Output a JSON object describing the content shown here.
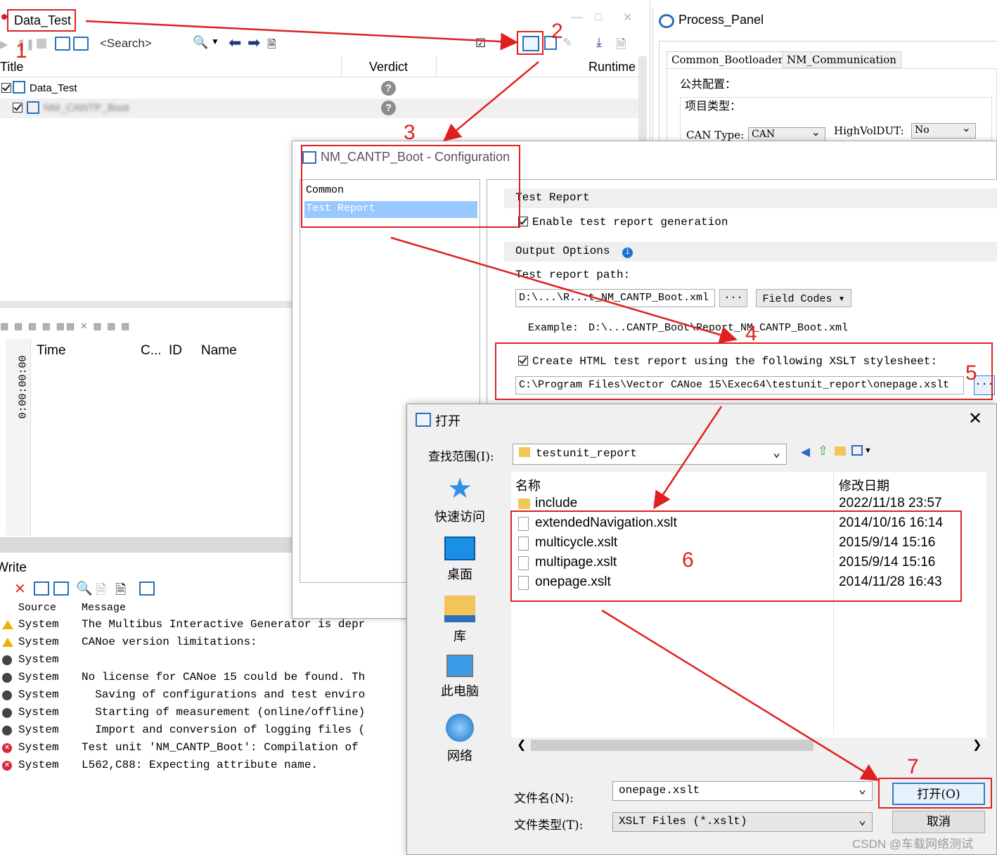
{
  "test_window": {
    "title": "Data_Test",
    "search_placeholder": "<Search>",
    "columns": [
      "Title",
      "Verdict",
      "Runtime"
    ],
    "rows": [
      {
        "label": "Data_Test",
        "verdict": "?"
      },
      {
        "label": "NM_CANTP_Boot",
        "verdict": "?"
      }
    ]
  },
  "process_panel": {
    "title": "Process_Panel",
    "tabs": [
      "Common_Bootloader",
      "NM_Communication"
    ],
    "group_common": "公共配置：",
    "group_project": "项目类型：",
    "can_type_label": "CAN Type:",
    "can_type_value": "CAN",
    "highvol_label": "HighVolDUT:",
    "highvol_value": "No"
  },
  "trace": {
    "time_col": "Time",
    "c_col": "C...",
    "id_col": "ID",
    "name_col": "Name",
    "time_value": "0:00:00:00"
  },
  "write": {
    "title": "Write",
    "columns": [
      "Source",
      "Message"
    ],
    "rows": [
      {
        "type": "warn",
        "source": "System",
        "message": "The Multibus Interactive Generator is depr"
      },
      {
        "type": "warn",
        "source": "System",
        "message": "CANoe version limitations:"
      },
      {
        "type": "info",
        "source": "System",
        "message": ""
      },
      {
        "type": "info",
        "source": "System",
        "message": "No license for CANoe 15 could be found. Th"
      },
      {
        "type": "info",
        "source": "System",
        "message": "  Saving of configurations and test enviro"
      },
      {
        "type": "info",
        "source": "System",
        "message": "  Starting of measurement (online/offline)"
      },
      {
        "type": "info",
        "source": "System",
        "message": "  Import and conversion of logging files ("
      },
      {
        "type": "error",
        "source": "System",
        "message": "Test unit 'NM_CANTP_Boot': Compilation of"
      },
      {
        "type": "error",
        "source": "System",
        "message": "L562,C88: Expecting attribute name."
      }
    ]
  },
  "config_dialog": {
    "title": "NM_CANTP_Boot - Configuration",
    "nav_items": [
      "Common",
      "Test Report"
    ],
    "selected_nav": "Test Report",
    "section_test_report": "Test Report",
    "enable_label": "Enable test report generation",
    "section_output": "Output Options",
    "path_label": "Test report path:",
    "path_value": "D:\\...\\R...t_NM_CANTP_Boot.xml",
    "browse_label": "...",
    "field_codes_label": "Field Codes",
    "example_label": "Example:",
    "example_value": "D:\\...CANTP_Boot\\Report_NM_CANTP_Boot.xml",
    "html_label": "Create HTML test report using the following XSLT stylesheet:",
    "xslt_path": "C:\\Program Files\\Vector CANoe 15\\Exec64\\testunit_report\\onepage.xslt",
    "xslt_browse": "..."
  },
  "open_dialog": {
    "title": "打开",
    "lookin_label": "查找范围(I):",
    "lookin_value": "testunit_report",
    "places": [
      "快速访问",
      "桌面",
      "库",
      "此电脑",
      "网络"
    ],
    "col_name": "名称",
    "col_date": "修改日期",
    "files": [
      {
        "name": "include",
        "date": "2022/11/18 23:57",
        "kind": "folder"
      },
      {
        "name": "extendedNavigation.xslt",
        "date": "2014/10/16 16:14",
        "kind": "file"
      },
      {
        "name": "multicycle.xslt",
        "date": "2015/9/14 15:16",
        "kind": "file"
      },
      {
        "name": "multipage.xslt",
        "date": "2015/9/14 15:16",
        "kind": "file"
      },
      {
        "name": "onepage.xslt",
        "date": "2014/11/28 16:43",
        "kind": "file"
      }
    ],
    "filename_label": "文件名(N):",
    "filename_value": "onepage.xslt",
    "filetype_label": "文件类型(T):",
    "filetype_value": "XSLT Files (*.xslt)",
    "open_button": "打开(O)",
    "cancel_button": "取消"
  },
  "annotations": [
    "1",
    "2",
    "3",
    "4",
    "5",
    "6",
    "7"
  ],
  "watermark": "CSDN @车载网络测试",
  "colors": {
    "annotation_red": "#e02020",
    "selection_blue": "#99c8ff",
    "accent_blue": "#2f7bd6"
  }
}
